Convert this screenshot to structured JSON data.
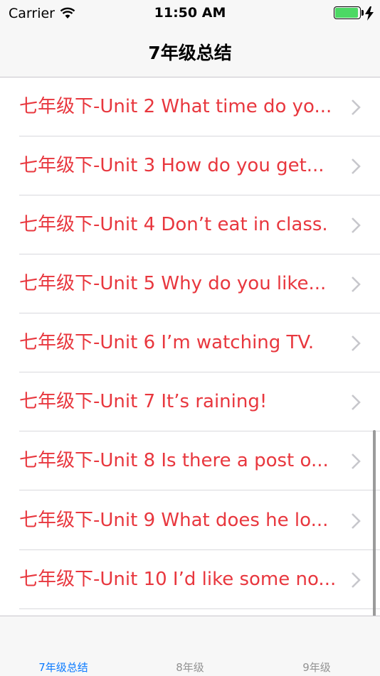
{
  "status_bar": {
    "carrier": "Carrier",
    "time": "11:50 AM",
    "battery_color": "#4cd964"
  },
  "nav": {
    "title": "7年级总结"
  },
  "list": {
    "text_color": "#e8373e",
    "items": [
      {
        "label": "七年级下-Unit 2 What time do yo..."
      },
      {
        "label": "七年级下-Unit 3 How do you get..."
      },
      {
        "label": "七年级下-Unit 4 Don’t eat in class."
      },
      {
        "label": "七年级下-Unit 5 Why do you like..."
      },
      {
        "label": "七年级下-Unit 6  I’m watching TV."
      },
      {
        "label": "七年级下-Unit 7 It’s raining!"
      },
      {
        "label": "七年级下-Unit 8 Is there a post o..."
      },
      {
        "label": "七年级下-Unit 9 What does he lo..."
      },
      {
        "label": "七年级下-Unit 10 I’d like some no..."
      }
    ]
  },
  "tab_bar": {
    "active_color": "#0a7aff",
    "tabs": [
      {
        "label": "7年级总结",
        "active": true
      },
      {
        "label": "8年级",
        "active": false
      },
      {
        "label": "9年级",
        "active": false
      }
    ]
  }
}
